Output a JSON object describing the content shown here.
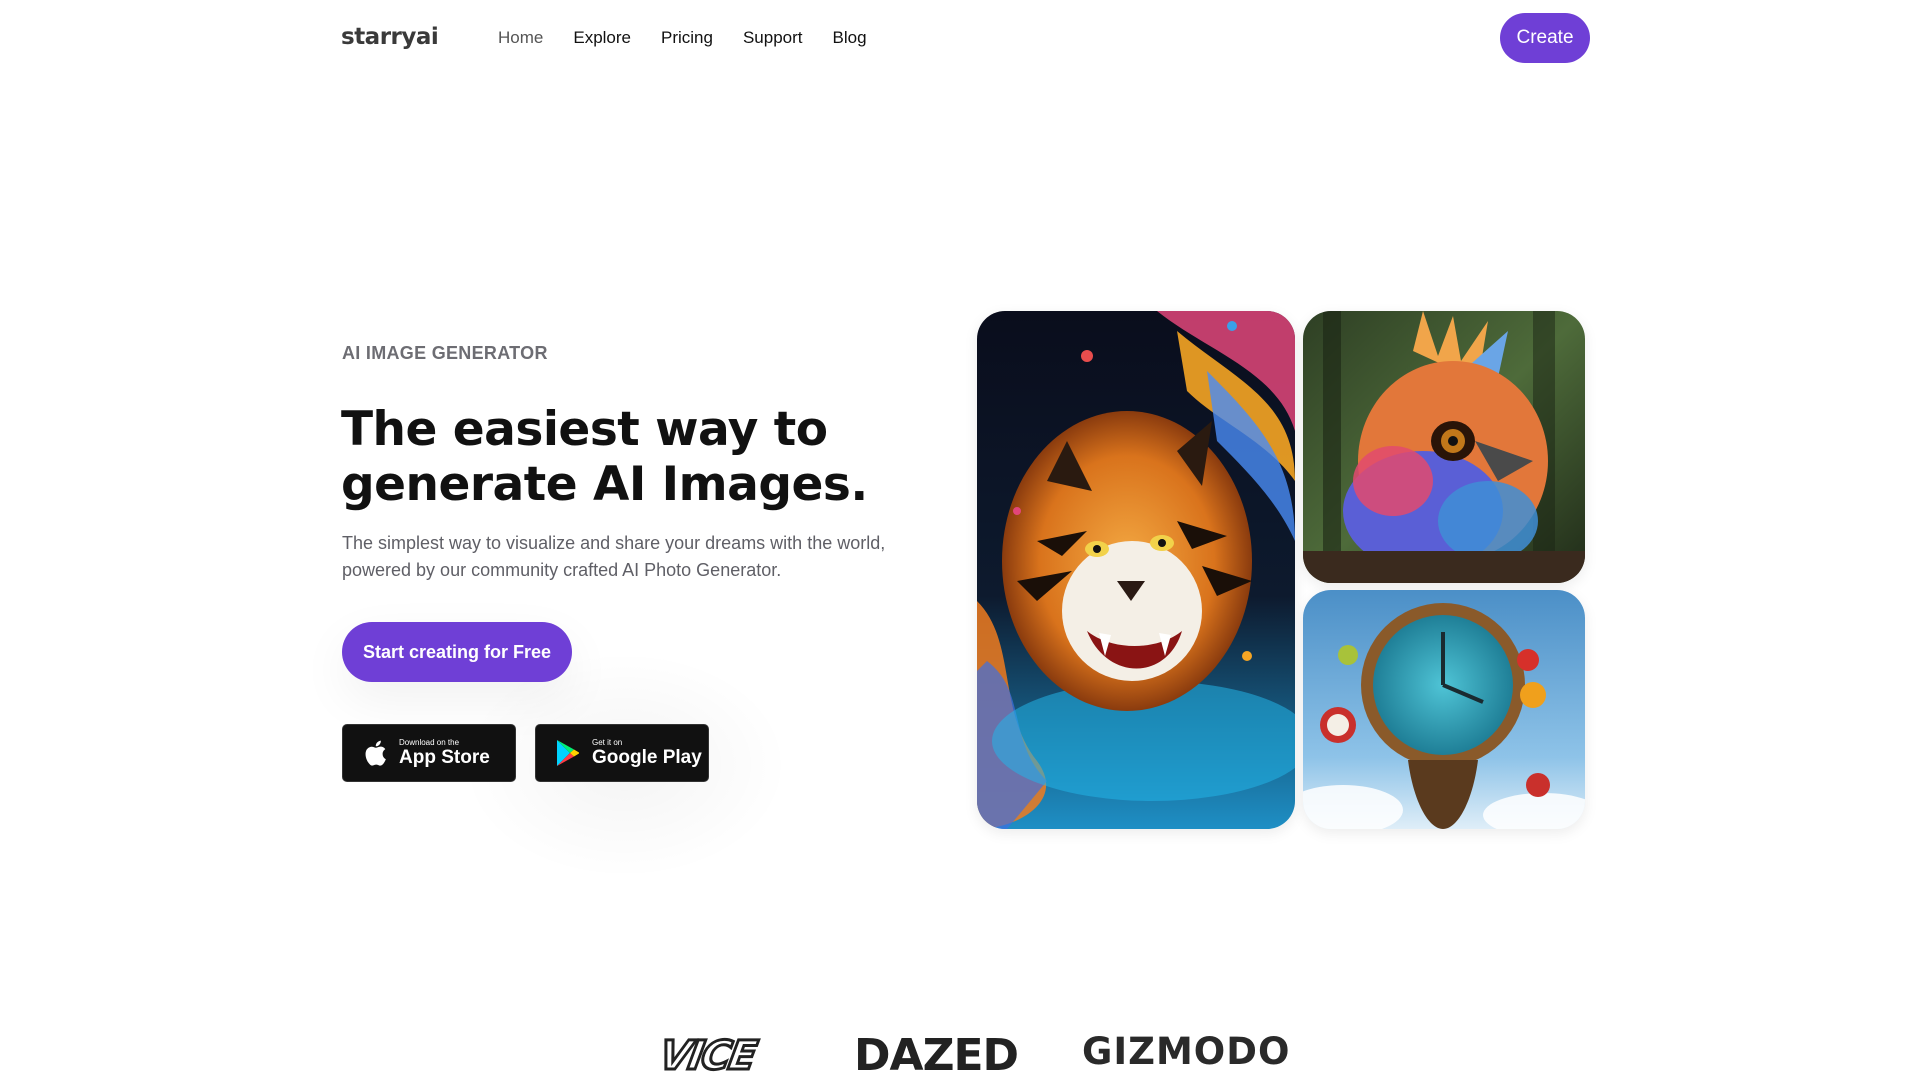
{
  "brand": {
    "name": "starryai"
  },
  "nav": {
    "items": [
      {
        "label": "Home",
        "active": true
      },
      {
        "label": "Explore"
      },
      {
        "label": "Pricing"
      },
      {
        "label": "Support"
      },
      {
        "label": "Blog"
      }
    ],
    "create_label": "Create"
  },
  "hero": {
    "eyebrow": "AI IMAGE GENERATOR",
    "headline_line1": "The easiest way to",
    "headline_line2": "generate AI Images.",
    "subtext": "The simplest way to visualize and share your dreams with the world, powered by our community crafted AI Photo Generator.",
    "cta_label": "Start creating for Free",
    "app_store": {
      "small": "Download on the",
      "big": "App Store"
    },
    "google_play": {
      "small": "Get it on",
      "big": "Google Play"
    }
  },
  "gallery": {
    "images": [
      "tiger-splash-art",
      "colorful-bird-art",
      "melting-clock-art"
    ]
  },
  "press": {
    "logos": [
      "VICE",
      "DAZED",
      "GIZMODO"
    ]
  },
  "colors": {
    "accent": "#6f3fd6",
    "text": "#111111",
    "muted": "#6d6d73"
  }
}
